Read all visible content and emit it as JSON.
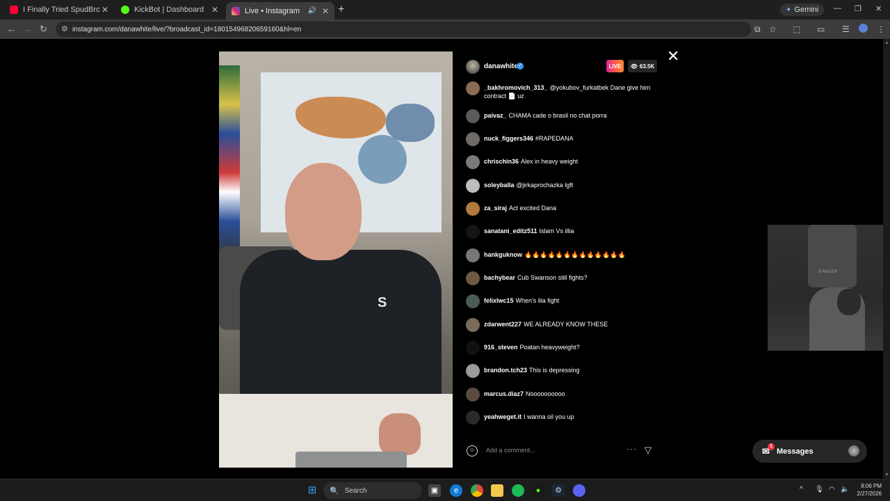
{
  "browser": {
    "tabs": [
      {
        "title": "I Finally Tried SpudBros In Lond",
        "favicon_color": "#ff0033",
        "icon": "youtube-icon"
      },
      {
        "title": "KickBot | Dashboard",
        "favicon_color": "#53fc18",
        "icon": "kickbot-icon"
      },
      {
        "title": "Live • Instagram",
        "favicon_color": "#e1306c",
        "icon": "instagram-icon"
      }
    ],
    "gemini_label": "Gemini",
    "url": "instagram.com/danawhite/live/?broadcast_id=18015496820659160&hl=en"
  },
  "live": {
    "host": "danawhite",
    "live_label": "LIVE",
    "viewer_count": "63.5K",
    "comments": [
      {
        "user": "_bakhromovich_313_",
        "text": "@yokubov_furkatbek Dane give him contract 📄 uz"
      },
      {
        "user": "paivaz_",
        "text": "CHAMA cade o brasil no chat porra"
      },
      {
        "user": "nuck_figgers346",
        "text": "#RAPEDANA"
      },
      {
        "user": "chrischin36",
        "text": "Alex in heavy weight"
      },
      {
        "user": "soleyballa",
        "text": "@jirkaprochazka lgft"
      },
      {
        "user": "za_siraj",
        "text": "Act excited Dana"
      },
      {
        "user": "sanatani_editz511",
        "text": "Islam Vs illia"
      },
      {
        "user": "hankguknow",
        "text": "🔥🔥🔥🔥🔥🔥🔥🔥🔥🔥🔥🔥🔥"
      },
      {
        "user": "bachybear",
        "text": "Cub Swanson still fights?"
      },
      {
        "user": "felixlwc15",
        "text": "When's ilia fight"
      },
      {
        "user": "zdarwent227",
        "text": "WE ALREADY KNOW THESE"
      },
      {
        "user": "916_steven",
        "text": "Poatan heavyweight?"
      },
      {
        "user": "brandon.tch23",
        "text": "This is depressing"
      },
      {
        "user": "marcus.diaz7",
        "text": "Noooooooooo"
      },
      {
        "user": "yeahweget.it",
        "text": "I wanna oil you up"
      }
    ],
    "comment_placeholder": "Add a comment..."
  },
  "webcam": {
    "chair_text": "S-RACER"
  },
  "video": {
    "shirt_logo": "S"
  },
  "messages": {
    "label": "Messages",
    "badge": "1"
  },
  "taskbar": {
    "search_label": "Search",
    "time": "8:06 PM",
    "date": "2/27/2026"
  }
}
